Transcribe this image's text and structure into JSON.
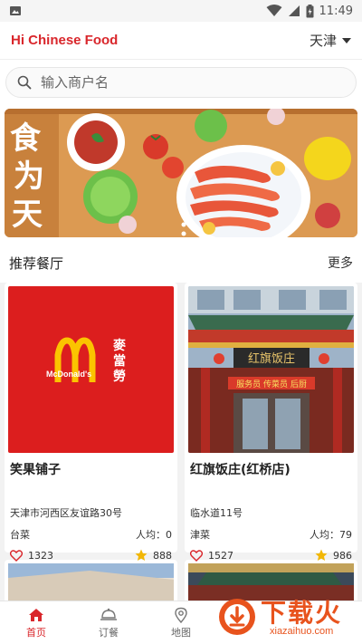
{
  "status": {
    "time": "11:49"
  },
  "header": {
    "title": "Hi Chinese Food",
    "city": "天津"
  },
  "search": {
    "placeholder": "输入商户名"
  },
  "banner": {
    "text": "食为天"
  },
  "section": {
    "title": "推荐餐厅",
    "more": "更多"
  },
  "restaurants": [
    {
      "name": "笑果铺子",
      "logo_text": "麥當勞",
      "logo_brand": "McDonald's",
      "address": "天津市河西区友谊路30号",
      "cuisine": "台菜",
      "avg_label": "人均：0",
      "likes": "1323",
      "rating": "888"
    },
    {
      "name": "红旗饭庄(红桥店)",
      "address": "临水道11号",
      "cuisine": "津菜",
      "avg_label": "人均：79",
      "likes": "1527",
      "rating": "986",
      "sign_text": "红旗饭庄",
      "banner_text": "服务员  传菜员  后厨"
    }
  ],
  "tabs": [
    {
      "label": "首页",
      "icon": "home-icon",
      "active": true
    },
    {
      "label": "订餐",
      "icon": "cloche-icon",
      "active": false
    },
    {
      "label": "地图",
      "icon": "map-pin-icon",
      "active": false
    }
  ],
  "watermark": {
    "text": "下载火",
    "url": "xiazaihuo.com"
  },
  "colors": {
    "accent": "#d9262b",
    "star": "#f2b705",
    "watermark": "#e8531d"
  }
}
